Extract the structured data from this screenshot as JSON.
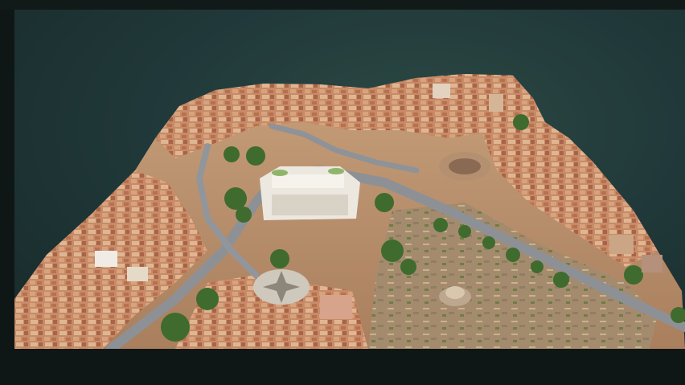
{
  "viewer": {
    "scene": "aerial-3d-city-model",
    "colors": {
      "background_top": "#2c4a44",
      "background_bottom": "#182a2a",
      "ground": "#b98c66",
      "roofs": "#c98a67",
      "roads": "#8b8f94",
      "trees": "#3f6b2f",
      "monument": "#e9e6df"
    }
  }
}
